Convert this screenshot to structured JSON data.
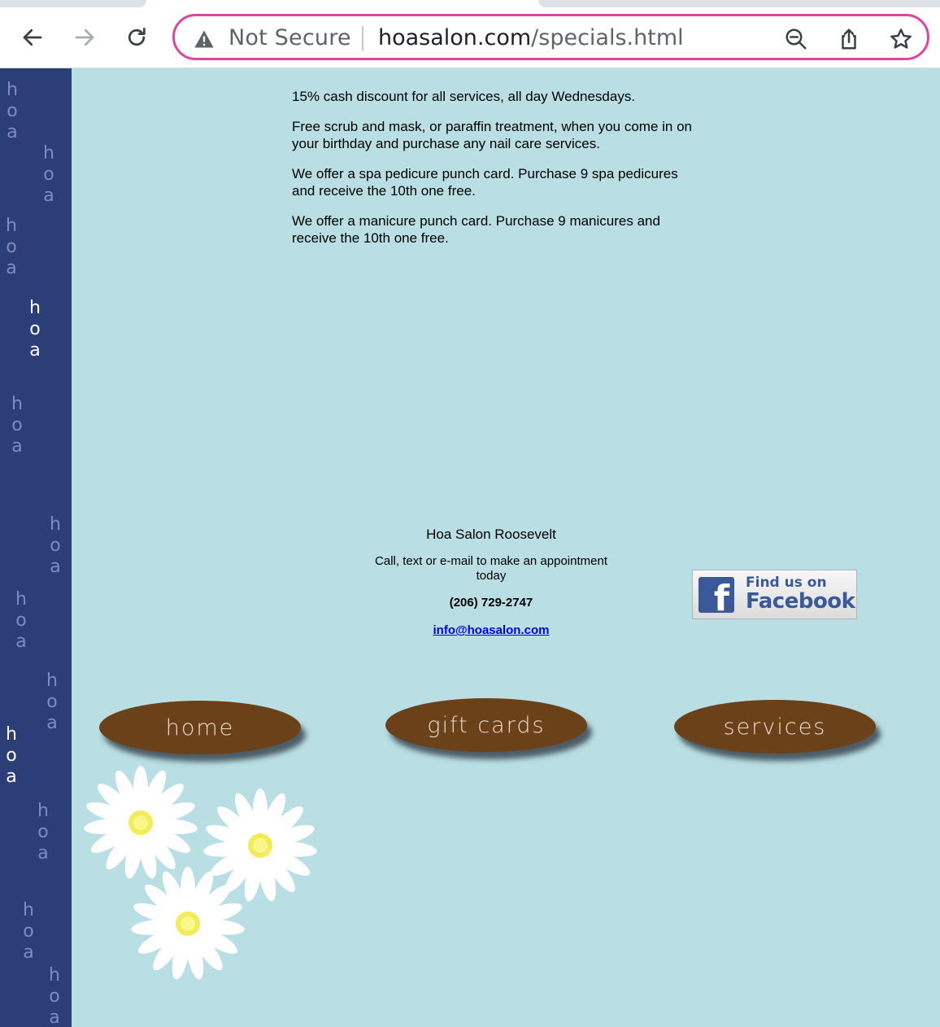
{
  "browser": {
    "security_label": "Not Secure",
    "url_host": "hoasalon.com",
    "url_path": "/specials.html",
    "accent_color": "#d9479e"
  },
  "sidebar": {
    "repeated_text": [
      "h",
      "o",
      "a"
    ],
    "background_color": "#2c3e78"
  },
  "specials": [
    "15% cash discount for all services, all day Wednesdays.",
    "Free scrub and mask, or paraffin treatment, when you come in on your birthday and purchase any nail care services.",
    "We offer a spa pedicure punch card. Purchase 9 spa pedicures and receive the 10th one free.",
    "We offer a manicure punch card. Purchase 9 manicures and receive the 10th one free."
  ],
  "contact": {
    "salon_name": "Hoa Salon Roosevelt",
    "call_text": "Call, text or e-mail to make an appointment today",
    "phone": "(206) 729-2747",
    "email": "info@hoasalon.com"
  },
  "facebook": {
    "line1": "Find us on",
    "line2": "Facebook",
    "logo_letter": "f"
  },
  "nav": {
    "home": "home",
    "gift_cards": "gift cards",
    "services": "services"
  },
  "colors": {
    "page_background": "#b9dfe4",
    "button_brown": "#6b4119"
  }
}
